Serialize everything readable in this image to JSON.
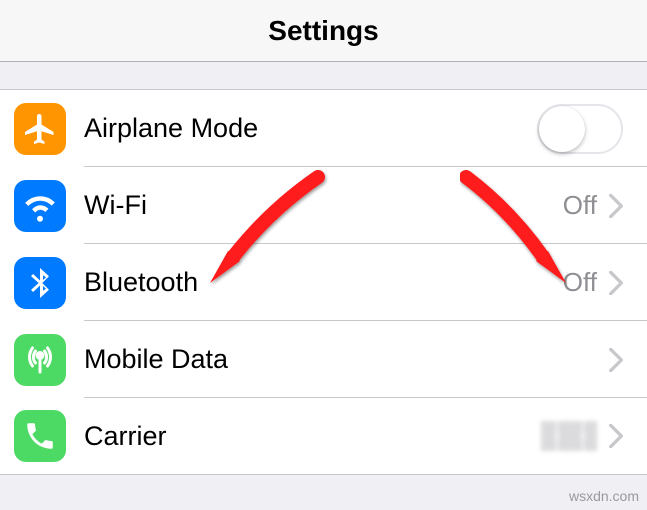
{
  "header": {
    "title": "Settings"
  },
  "rows": {
    "airplane": {
      "label": "Airplane Mode",
      "icon_color": "#ff9500",
      "toggle_on": false
    },
    "wifi": {
      "label": "Wi-Fi",
      "icon_color": "#007aff",
      "status": "Off"
    },
    "bluetooth": {
      "label": "Bluetooth",
      "icon_color": "#007aff",
      "status": "Off"
    },
    "mobile": {
      "label": "Mobile Data",
      "icon_color": "#4cd964",
      "status": ""
    },
    "carrier": {
      "label": "Carrier",
      "icon_color": "#4cd964",
      "status_obscured": true
    }
  },
  "annotation_arrows": [
    {
      "target": "bluetooth-label"
    },
    {
      "target": "bluetooth-status"
    }
  ],
  "watermark": "wsxdn.com"
}
